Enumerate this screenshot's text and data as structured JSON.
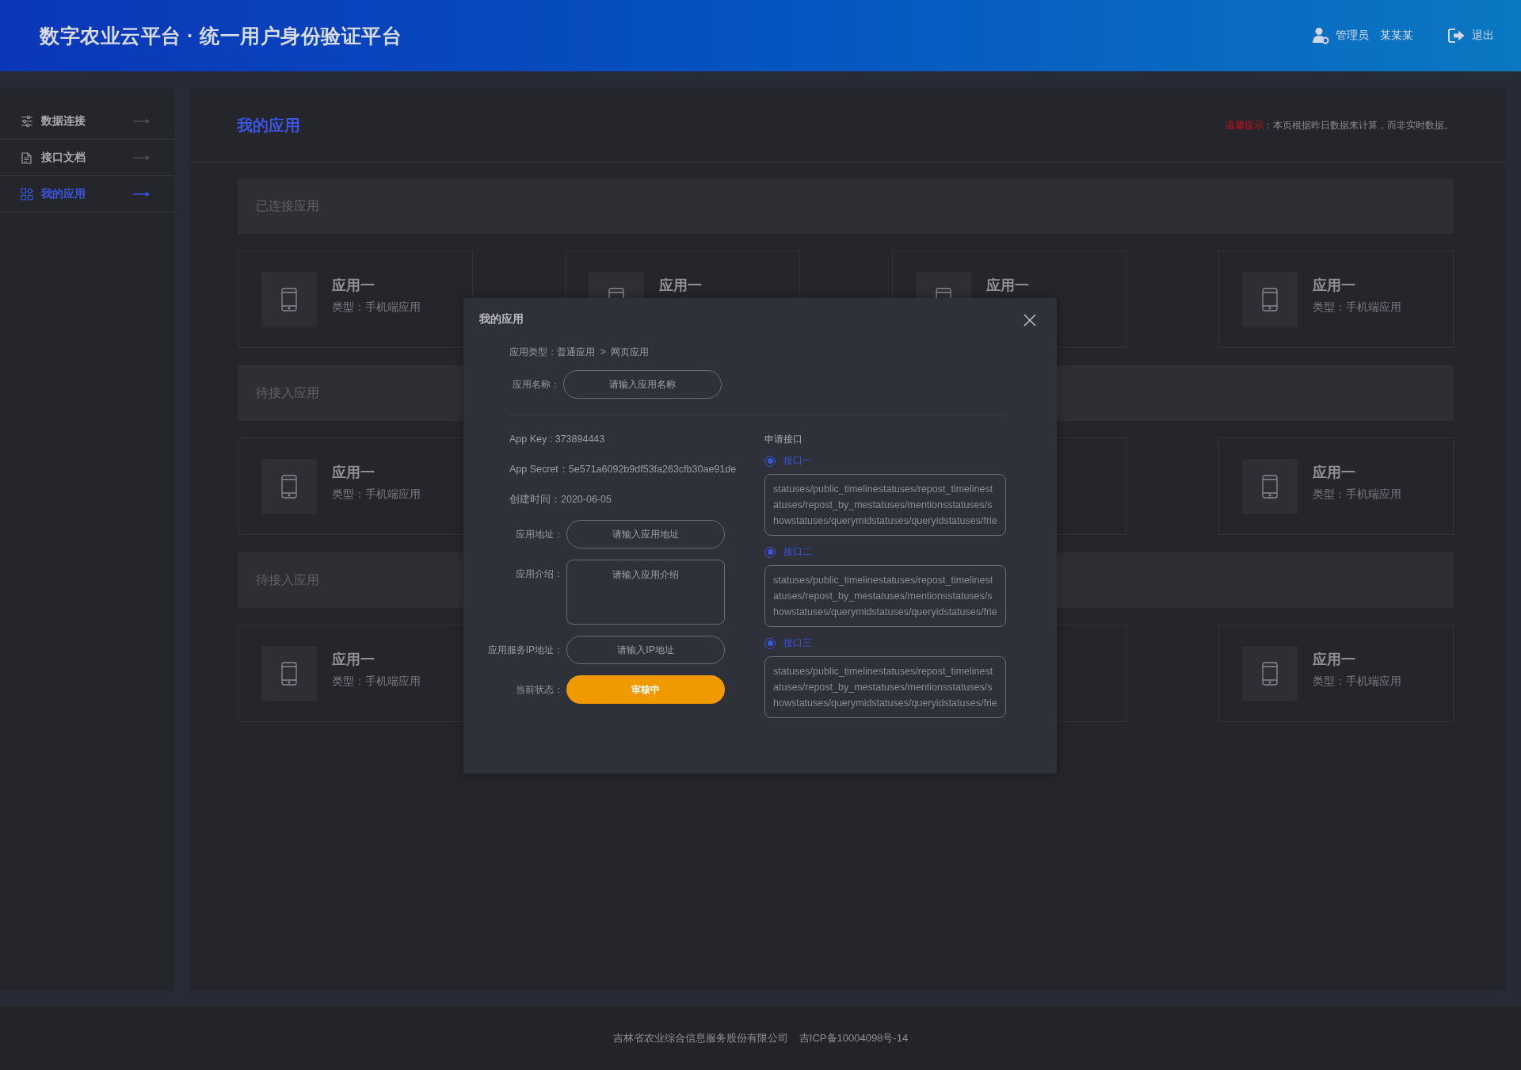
{
  "header": {
    "title": "数字农业云平台 · 统一用户身份验证平台",
    "user_role": "管理员",
    "user_name": "某某某",
    "logout": "退出"
  },
  "sidebar": {
    "items": [
      {
        "label": "数据连接",
        "kind": "sliders",
        "selected": false
      },
      {
        "label": "接口文档",
        "kind": "document",
        "selected": false
      },
      {
        "label": "我的应用",
        "kind": "apps",
        "selected": true
      }
    ]
  },
  "page": {
    "title": "我的应用",
    "notice_label": "温馨提示",
    "notice_text": "：本页根据昨日数据来计算，而非实时数据。"
  },
  "sections": [
    {
      "title": "已连接应用",
      "cards": [
        {
          "kind": "app",
          "name": "应用一",
          "type": "类型：手机端应用"
        },
        {
          "kind": "app",
          "name": "应用一"
        },
        {
          "kind": "app",
          "name": "应用一"
        },
        {
          "kind": "app",
          "name": "应用一",
          "type": "类型：手机端应用"
        }
      ]
    },
    {
      "title": "待接入应用",
      "cards": [
        {
          "kind": "app",
          "name": "应用一",
          "type": "类型：手机端应用"
        },
        {
          "kind": "covered"
        },
        {
          "kind": "covered"
        },
        {
          "kind": "app",
          "name": "应用一",
          "type": "类型：手机端应用"
        }
      ]
    },
    {
      "title": "待接入应用",
      "cards": [
        {
          "kind": "app",
          "name": "应用一",
          "type": "类型：手机端应用"
        },
        {
          "kind": "covered"
        },
        {
          "kind": "covered"
        },
        {
          "kind": "app",
          "name": "应用一",
          "type": "类型：手机端应用"
        }
      ]
    }
  ],
  "modal": {
    "title": "我的应用",
    "breadcrumb": "应用类型：普通应用  >  网页应用",
    "name_field": {
      "label": "应用名称：",
      "placeholder": "请输入应用名称"
    },
    "details": [
      {
        "kind": "text",
        "text": "App  Key : 373894443"
      },
      {
        "kind": "text",
        "text": "App Secret：5e571a6092b9df53fa263cfb30ae91de"
      },
      {
        "kind": "text",
        "text": "创建时间：2020-06-05"
      },
      {
        "kind": "input",
        "label": "应用地址：",
        "placeholder": "请输入应用地址"
      },
      {
        "kind": "textarea",
        "label": "应用介绍：",
        "placeholder": "请输入应用介绍"
      },
      {
        "kind": "input",
        "label": "应用服务IP地址：",
        "placeholder": "请输入IP地址"
      },
      {
        "kind": "status",
        "label": "当前状态：",
        "value": "审核中"
      }
    ],
    "interfaces_title": "申请接口",
    "interfaces": [
      {
        "label": "接口一",
        "selected": true,
        "text": "statuses/public_timelinestatuses/repost_timelinestatuses/repost_by_mestatuses/mentionsstatuses/showstatuses/querymidstatuses/queryidstatuses/frie"
      },
      {
        "label": "接口二",
        "selected": true,
        "text": "statuses/public_timelinestatuses/repost_timelinestatuses/repost_by_mestatuses/mentionsstatuses/showstatuses/querymidstatuses/queryidstatuses/frie"
      },
      {
        "label": "接口三",
        "selected": true,
        "text": "statuses/public_timelinestatuses/repost_timelinestatuses/repost_by_mestatuses/mentionsstatuses/showstatuses/querymidstatuses/queryidstatuses/frie"
      }
    ]
  },
  "footer": {
    "company": "吉林省农业综合信息服务股份有限公司",
    "icp": "吉ICP备10004098号-14"
  }
}
